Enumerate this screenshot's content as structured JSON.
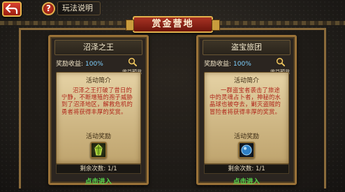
{
  "topbar": {
    "help_label": "玩法说明",
    "help_glyph": "?"
  },
  "page_title": "赏金营地",
  "cards": [
    {
      "title": "沼泽之王",
      "reward_label": "奖励收益:",
      "reward_value": "100%",
      "preview_label": "收益预览",
      "intro_title": "活动简介",
      "description": "沼泽之王打破了昔日的宁静，不断增殖的孢子威胁到了沼泽地区，解救危机的勇者将获得丰厚的奖赏。",
      "reward_title": "活动奖励",
      "reward_item_icon": "green-gem-icon",
      "remaining_label": "剩余次数:",
      "remaining_value": "1/1",
      "enter_label": "点击进入"
    },
    {
      "title": "盗宝旅团",
      "reward_label": "奖励收益:",
      "reward_value": "100%",
      "preview_label": "收益预览",
      "intro_title": "活动简介",
      "description": "一群盗宝者袭击了旅途中的灵魂占卜者，神秘的水晶球也被夺去，剿灭盗贼的冒险者将获得丰厚的奖赏。",
      "reward_title": "活动奖励",
      "reward_item_icon": "blue-orb-icon",
      "remaining_label": "剩余次数:",
      "remaining_value": "1/1",
      "enter_label": "点击进入"
    }
  ],
  "colors": {
    "accent_gold": "#e2b04c",
    "title_red": "#a83324",
    "description_red": "#b0261a",
    "enter_green": "#57d34a",
    "percent_blue": "#7fd1ff"
  }
}
